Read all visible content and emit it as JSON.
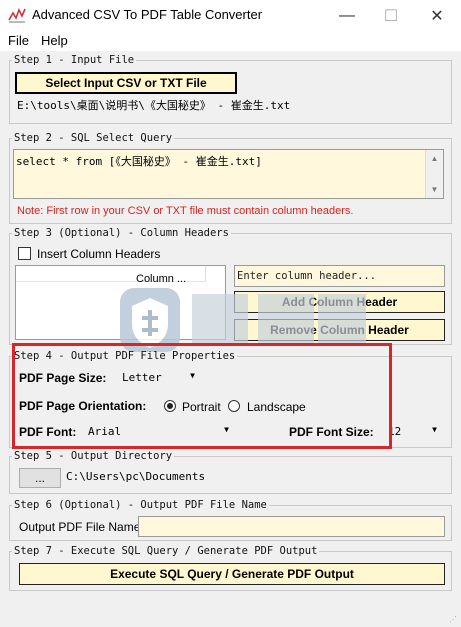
{
  "window": {
    "title": "Advanced CSV To PDF Table Converter",
    "minimize_glyph": "—",
    "maximize_glyph": "☐",
    "close_glyph": "✕"
  },
  "menu": [
    "File",
    "Help"
  ],
  "step1": {
    "legend": "Step 1 - Input File",
    "button": "Select Input CSV or TXT File",
    "path": "E:\\tools\\桌面\\说明书\\《大国秘史》 - 崔金生.txt"
  },
  "step2": {
    "legend": "Step 2 - SQL Select Query",
    "query": "select * from [《大国秘史》 - 崔金生.txt]",
    "note": "Note: First row in your CSV or TXT file must contain column headers.",
    "note_color": "#e0201c"
  },
  "step3": {
    "legend": "Step 3 (Optional) - Column Headers",
    "checkbox_label": "Insert Column Headers",
    "list_header": "Column ...",
    "input_placeholder": "Enter column header...",
    "add_button": "Add Column Header",
    "remove_button": "Remove Column Header"
  },
  "step4": {
    "legend": "Step 4 - Output PDF File Properties",
    "page_size_label": "PDF Page Size:",
    "page_size_value": "Letter",
    "orientation_label": "PDF Page Orientation:",
    "orientation_options": [
      "Portrait",
      "Landscape"
    ],
    "orientation_selected": "Portrait",
    "font_label": "PDF Font:",
    "font_value": "Arial",
    "font_size_label": "PDF Font Size:",
    "font_size_value": "12"
  },
  "step5": {
    "legend": "Step 5 - Output Directory",
    "browse_button": "...",
    "path": "C:\\Users\\pc\\Documents"
  },
  "step6": {
    "legend": "Step 6 (Optional) - Output PDF File Name",
    "label": "Output PDF File Name:",
    "value": ""
  },
  "step7": {
    "legend": "Step 7 - Execute SQL Query / Generate PDF Output",
    "button": "Execute SQL Query / Generate PDF Output"
  },
  "colors": {
    "highlight_border": "#d6262b",
    "button_yellow": "#fff7cf",
    "textbox_yellow": "#fff8dc"
  }
}
